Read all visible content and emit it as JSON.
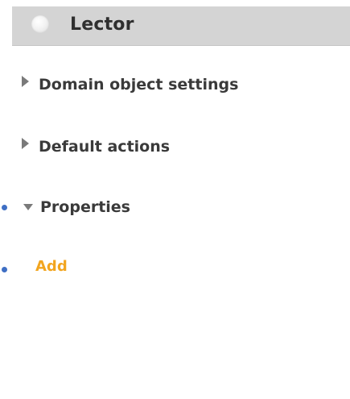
{
  "header": {
    "title": "Lector",
    "status_icon": "status-dot-icon",
    "background": "#d4d4d4"
  },
  "sections": [
    {
      "label": "Domain object settings",
      "expanded": false,
      "icon": "caret-right-icon"
    },
    {
      "label": "Default actions",
      "expanded": false,
      "icon": "caret-right-icon"
    },
    {
      "label": "Properties",
      "expanded": true,
      "icon": "caret-down-icon"
    }
  ],
  "actions": {
    "add_label": "Add",
    "add_color": "#f2a51f"
  },
  "bullets": {
    "color": "#3f6fc4"
  }
}
